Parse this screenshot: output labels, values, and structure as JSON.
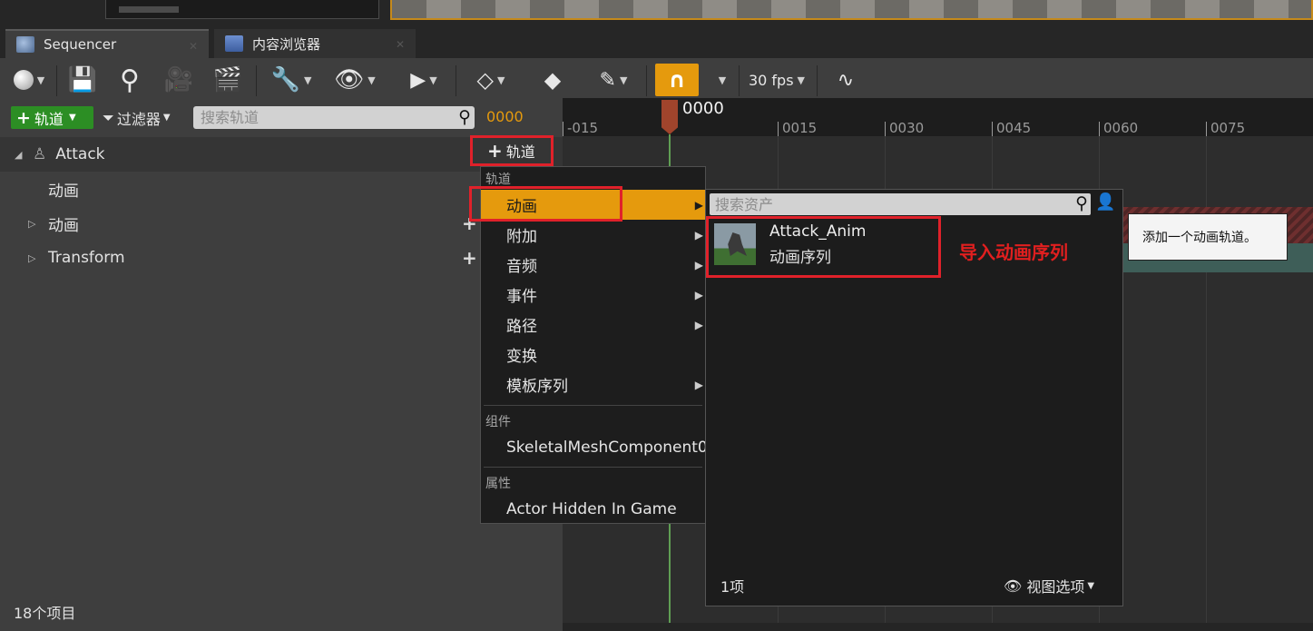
{
  "tabs": [
    {
      "label": "Sequencer",
      "close": "✕"
    },
    {
      "label": "内容浏览器",
      "close": "✕"
    }
  ],
  "toolbar": {
    "fps_label": "30 fps",
    "icons": [
      "world-icon",
      "save-icon",
      "search-icon",
      "camera-icon",
      "clapper-icon",
      "wrench-icon",
      "eye-icon",
      "play-icon",
      "keyframe-icon",
      "key-tag-icon",
      "pencil-icon",
      "snap-magnet-icon",
      "curve-editor-icon"
    ]
  },
  "search_row": {
    "add_track_label": "轨道",
    "filter_label": "过滤器",
    "search_placeholder": "搜索轨道",
    "current_time": "0000"
  },
  "outliner": {
    "items": [
      {
        "label": "Attack"
      },
      {
        "label": "动画"
      },
      {
        "label": "动画"
      },
      {
        "label": "Transform"
      }
    ],
    "status": "18个项目"
  },
  "timeline": {
    "playhead_label": "0000",
    "ticks": [
      "-015",
      "0015",
      "0030",
      "0045",
      "0060",
      "0075"
    ]
  },
  "add_track_button": {
    "label": "轨道"
  },
  "track_menu": {
    "header_tracks": "轨道",
    "items": [
      {
        "label": "动画",
        "submenu": true
      },
      {
        "label": "附加",
        "submenu": true
      },
      {
        "label": "音频",
        "submenu": true
      },
      {
        "label": "事件",
        "submenu": true
      },
      {
        "label": "路径",
        "submenu": true
      },
      {
        "label": "变换",
        "submenu": false
      },
      {
        "label": "模板序列",
        "submenu": true
      }
    ],
    "header_components": "组件",
    "component": "SkeletalMeshComponent0",
    "header_properties": "属性",
    "property": "Actor Hidden In Game"
  },
  "asset_picker": {
    "search_placeholder": "搜索资产",
    "asset_name": "Attack_Anim",
    "asset_type": "动画序列",
    "item_count": "1项",
    "view_options": "视图选项"
  },
  "annotation": "导入动画序列",
  "tooltip": "添加一个动画轨道。",
  "colors": {
    "accent": "#e59a0d",
    "annotation_red": "#e0212a",
    "add_green": "#2c8e24"
  }
}
